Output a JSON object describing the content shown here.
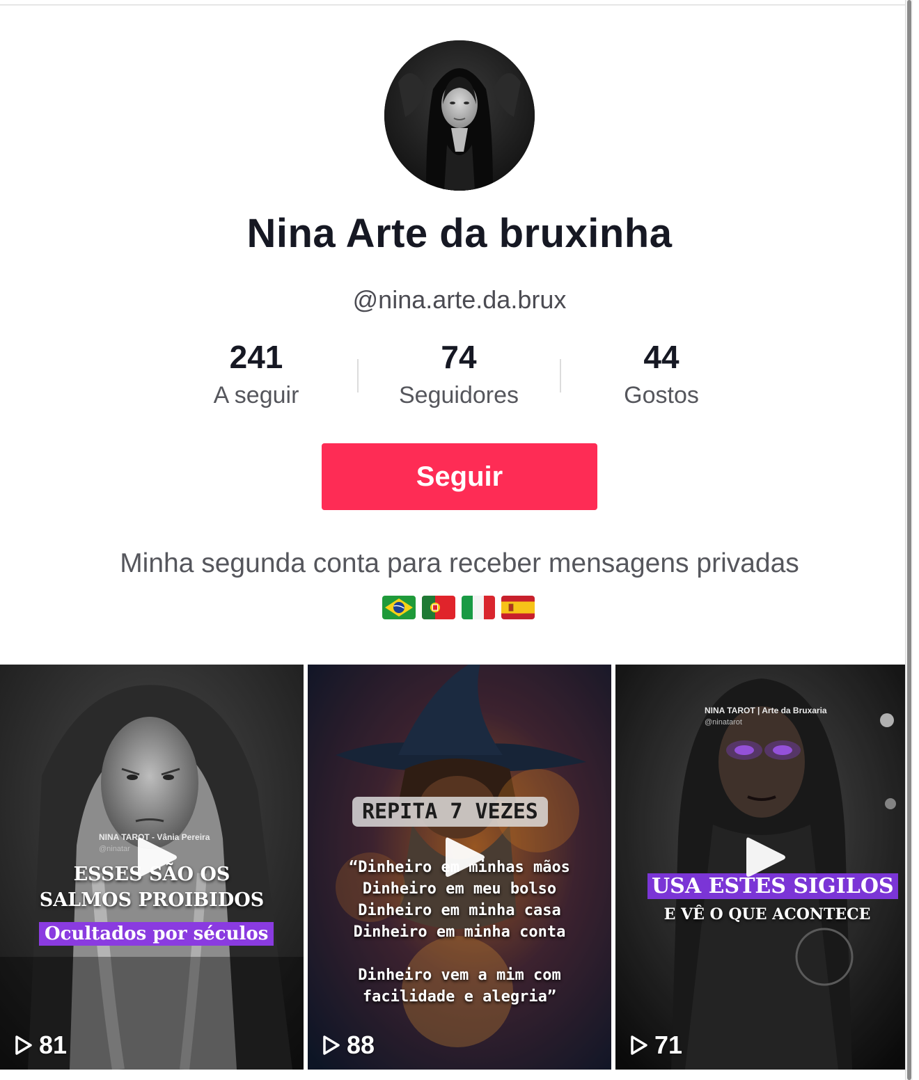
{
  "profile": {
    "display_name": "Nina Arte da bruxinha",
    "username": "@nina.arte.da.brux",
    "bio": "Minha segunda conta para receber mensagens privadas",
    "flags": [
      "brazil-flag",
      "portugal-flag",
      "italy-flag",
      "spain-flag"
    ]
  },
  "stats": [
    {
      "value": "241",
      "label": "A seguir"
    },
    {
      "value": "74",
      "label": "Seguidores"
    },
    {
      "value": "44",
      "label": "Gostos"
    }
  ],
  "actions": {
    "follow_label": "Seguir"
  },
  "colors": {
    "follow_button": "#fe2c55",
    "text_primary": "#161823",
    "text_secondary": "#55565c",
    "overlay_purple": "#8a3be0"
  },
  "videos": [
    {
      "views": "81",
      "overlay": {
        "account": "NINA TAROT - Vânia Pereira",
        "handle": "@ninatar",
        "line1": "ESSES SÃO OS",
        "line2": "SALMOS PROIBIDOS",
        "highlight": "Ocultados por séculos"
      }
    },
    {
      "views": "88",
      "overlay": {
        "title": "REPITA 7 VEZES",
        "lines": [
          "“Dinheiro em minhas mãos",
          "Dinheiro em meu bolso",
          "Dinheiro em minha casa",
          "Dinheiro em minha conta",
          "",
          "Dinheiro vem a mim com",
          "facilidade e alegria”"
        ]
      }
    },
    {
      "views": "71",
      "overlay": {
        "account": "NINA TAROT | Arte da Bruxaria",
        "handle": "@ninatarot",
        "highlight": "USA ESTES SIGILOS",
        "subline": "E VÊ O QUE ACONTECE"
      }
    }
  ]
}
